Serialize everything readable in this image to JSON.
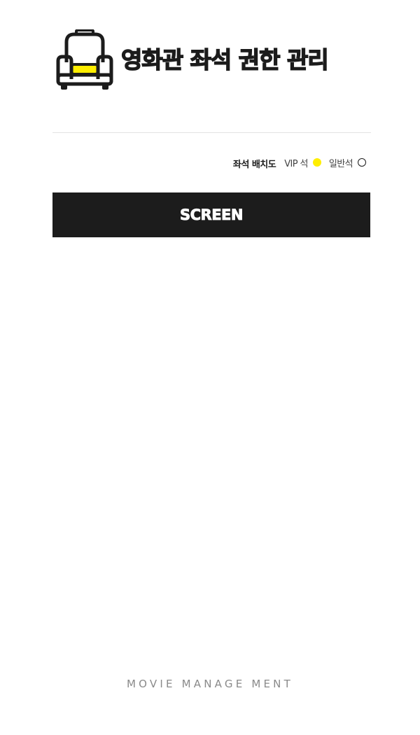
{
  "header": {
    "title": "영화관 좌석 권한 관리",
    "logo_icon": "armchair-icon"
  },
  "legend": {
    "title": "좌석 배치도",
    "vip_label": "VIP 석",
    "normal_label": "일반석",
    "vip_icon": "filled-circle-icon",
    "normal_icon": "hollow-circle-icon"
  },
  "screen": {
    "label": "SCREEN"
  },
  "seats": [],
  "footer": {
    "text": "MOVIE MANAGE MENT"
  },
  "colors": {
    "accent": "#ffee00",
    "dark": "#1c1c1c",
    "background": "#ffffff",
    "footer_text": "#8a8a8a"
  }
}
